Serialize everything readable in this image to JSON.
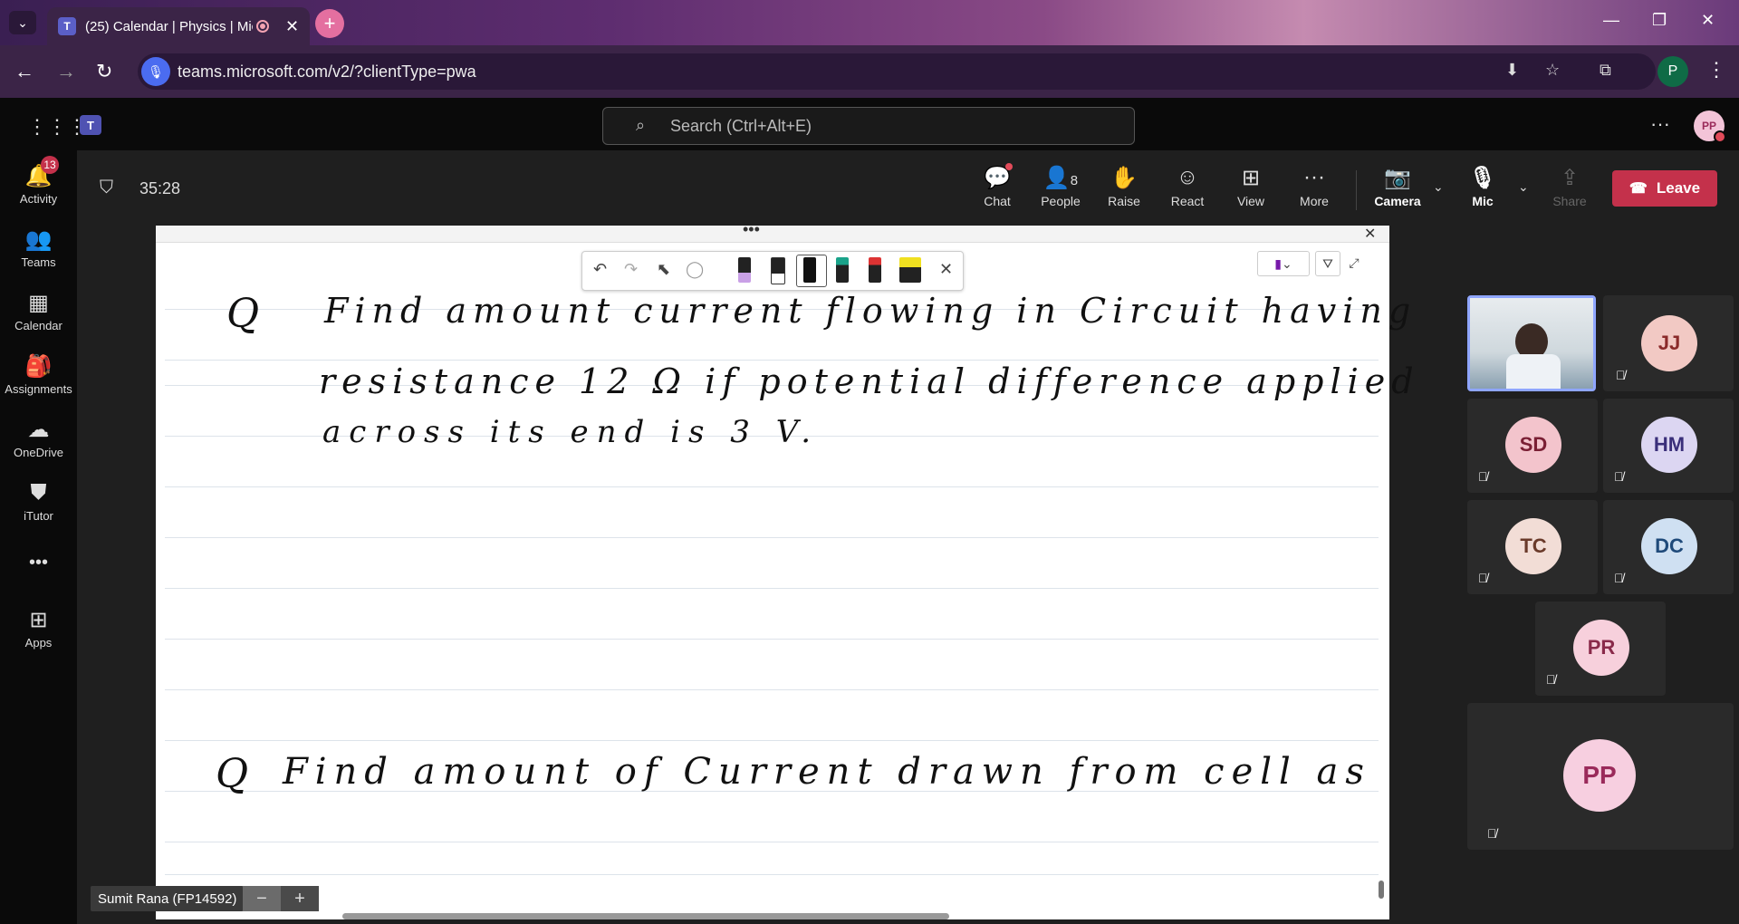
{
  "browser": {
    "tab_title": "(25) Calendar | Physics | Mic",
    "tab_close": "✕",
    "new_tab": "+",
    "url": "teams.microsoft.com/v2/?clientType=pwa",
    "profile_initial": "P"
  },
  "header": {
    "search_placeholder": "Search (Ctrl+Alt+E)",
    "avatar_initials": "PP"
  },
  "rail": {
    "items": [
      {
        "label": "Activity",
        "icon": "bell-icon",
        "badge": "13"
      },
      {
        "label": "Teams",
        "icon": "teams-icon"
      },
      {
        "label": "Calendar",
        "icon": "calendar-icon"
      },
      {
        "label": "Assignments",
        "icon": "assignments-icon"
      },
      {
        "label": "OneDrive",
        "icon": "cloud-icon"
      },
      {
        "label": "iTutor",
        "icon": "itutor-icon"
      },
      {
        "label": "Apps",
        "icon": "apps-icon"
      }
    ],
    "more": "•••"
  },
  "meeting": {
    "timer": "35:28",
    "buttons": {
      "chat": "Chat",
      "people": "People",
      "people_count": "8",
      "raise": "Raise",
      "react": "React",
      "view": "View",
      "more": "More",
      "camera": "Camera",
      "mic": "Mic",
      "share": "Share"
    },
    "leave": "Leave"
  },
  "whiteboard": {
    "line1_q": "Q",
    "line1": "Find amount current flowing in Circuit having",
    "line2": "resistance 12 Ω if potential difference applied",
    "line3": "across its end is 3 V.",
    "line4_q": "Q",
    "line4": "Find amount of Current drawn from cell as",
    "dots": "•••"
  },
  "presenter": {
    "name": "Sumit Rana (FP14592)",
    "zoom_out": "−",
    "zoom_in": "+"
  },
  "participants": [
    {
      "initials": "JJ",
      "color": "#f2c9c4",
      "text": "#8a2a2a"
    },
    {
      "initials": "SD",
      "color": "#f3c4cc",
      "text": "#7a1f34"
    },
    {
      "initials": "HM",
      "color": "#dcd6f2",
      "text": "#3a2f7a"
    },
    {
      "initials": "TC",
      "color": "#f2ddd6",
      "text": "#6a3a2a"
    },
    {
      "initials": "DC",
      "color": "#cfe0f2",
      "text": "#1f4a7a"
    },
    {
      "initials": "PR",
      "color": "#f7d0dc",
      "text": "#8a2a4a"
    },
    {
      "initials": "PP",
      "color": "#f7cfe0",
      "text": "#9a2a5a"
    }
  ],
  "colors": {
    "accent": "#5b5fc7",
    "leave": "#c4314b",
    "badge": "#c4314b",
    "selected_tile_border": "#8fa6ff"
  }
}
